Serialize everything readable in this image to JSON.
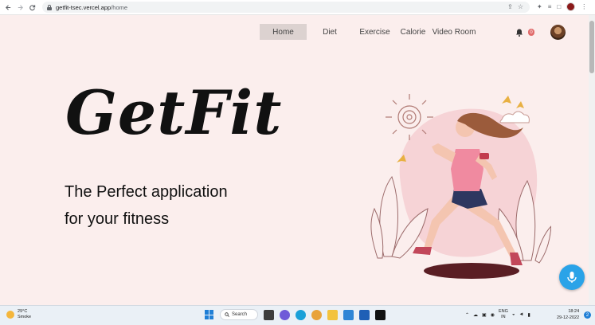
{
  "browser": {
    "url_host": "getfit-tsec.vercel.app",
    "url_path": "/home"
  },
  "nav": {
    "items": [
      {
        "label": "Home",
        "active": true
      },
      {
        "label": "Diet",
        "active": false
      },
      {
        "label": "Exercise",
        "active": false
      },
      {
        "label": "Calorie",
        "active": false
      },
      {
        "label": "Video Room",
        "active": false
      }
    ],
    "notification_count": "0"
  },
  "hero": {
    "title": "GetFit",
    "tagline_line1": "The Perfect application",
    "tagline_line2": "for your fitness"
  },
  "taskbar": {
    "weather_temp": "29°C",
    "weather_desc": "Smoke",
    "search_label": "Search",
    "lang_line1": "ENG",
    "lang_line2": "IN",
    "time": "18:24",
    "date": "29-12-2022",
    "notif_count": "2"
  },
  "colors": {
    "page_bg": "#fbeeed",
    "nav_active": "#dcd2d0",
    "mic_button": "#2aa3e8"
  },
  "icons": [
    "back-icon",
    "forward-icon",
    "reload-icon",
    "lock-icon",
    "share-icon",
    "star-icon",
    "extension-icon",
    "media-icon",
    "sidepanel-icon",
    "menu-icon",
    "bell-icon",
    "mic-icon",
    "windows-icon",
    "search-icon"
  ]
}
